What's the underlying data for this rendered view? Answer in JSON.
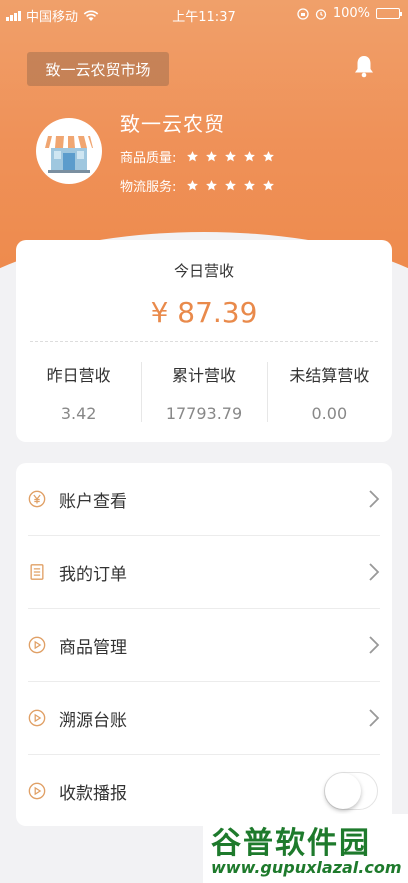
{
  "status_bar": {
    "carrier": "中国移动",
    "time": "上午11:37",
    "battery": "100%",
    "icons": [
      "signal-icon",
      "wifi-icon",
      "orientation-lock-icon",
      "alarm-icon",
      "battery-icon"
    ]
  },
  "header": {
    "market_button": "致一云农贸市场",
    "shop_name": "致一云农贸",
    "ratings": [
      {
        "label": "商品质量:",
        "stars": 5
      },
      {
        "label": "物流服务:",
        "stars": 5
      }
    ]
  },
  "revenue": {
    "title": "今日营收",
    "amount": "¥ 87.39",
    "stats": [
      {
        "label": "昨日营收",
        "value": "3.42"
      },
      {
        "label": "累计营收",
        "value": "17793.79"
      },
      {
        "label": "未结算营收",
        "value": "0.00"
      }
    ]
  },
  "menu": {
    "items": [
      {
        "label": "账户查看",
        "icon": "yen-circle-icon"
      },
      {
        "label": "我的订单",
        "icon": "document-icon"
      },
      {
        "label": "商品管理",
        "icon": "play-circle-icon"
      },
      {
        "label": "溯源台账",
        "icon": "play-circle-icon"
      },
      {
        "label": "收款播报",
        "icon": "play-circle-icon",
        "toggle": false
      }
    ]
  },
  "watermark": {
    "title": "谷普软件园",
    "url": "www.gupuxlazal.com"
  },
  "colors": {
    "accent": "#ee8a4c",
    "amount": "#e98a4b",
    "watermark": "#1e7a2c"
  }
}
